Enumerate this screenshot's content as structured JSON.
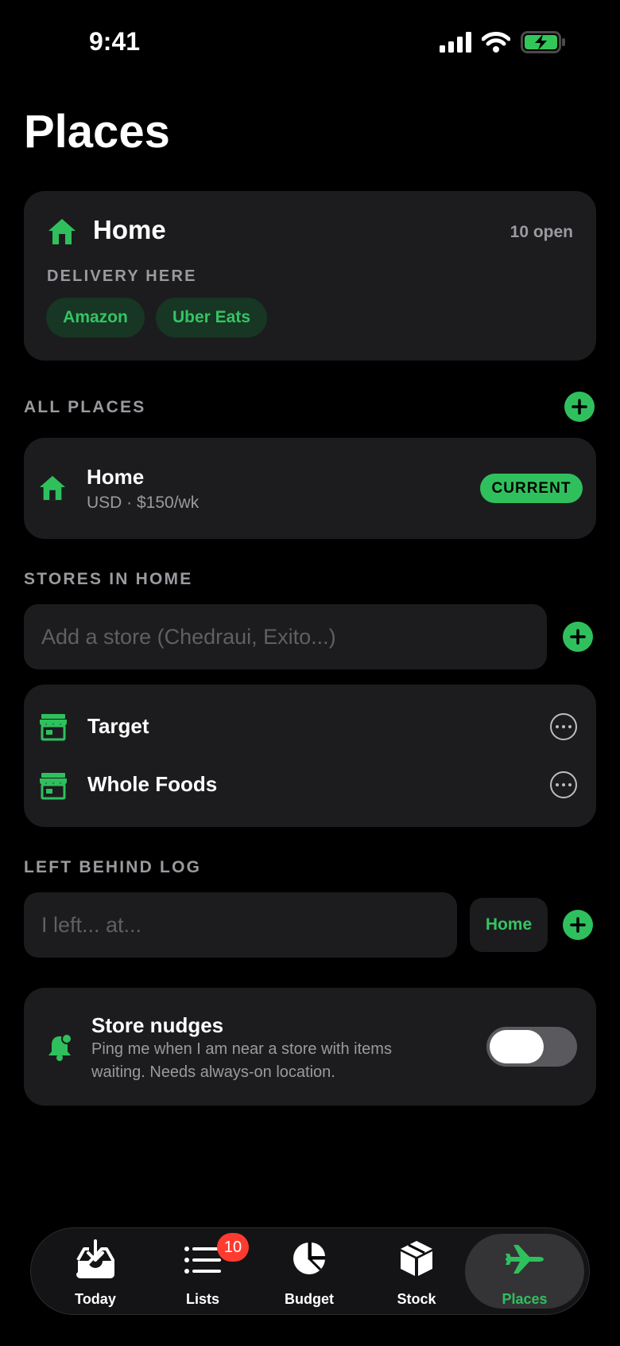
{
  "status_bar": {
    "time": "9:41"
  },
  "page": {
    "title": "Places"
  },
  "current_place": {
    "name": "Home",
    "open_count": "10 open",
    "delivery_label": "DELIVERY HERE",
    "delivery_services": [
      "Amazon",
      "Uber Eats"
    ]
  },
  "all_places": {
    "section_label": "ALL PLACES",
    "items": [
      {
        "name": "Home",
        "detail": "USD · $150/wk",
        "badge": "CURRENT"
      }
    ]
  },
  "stores": {
    "section_label": "STORES IN HOME",
    "input_placeholder": "Add a store (Chedraui, Exito...)",
    "items": [
      {
        "name": "Target"
      },
      {
        "name": "Whole Foods"
      }
    ]
  },
  "left_behind": {
    "section_label": "LEFT BEHIND LOG",
    "input_placeholder": "I left... at...",
    "place_value": "Home"
  },
  "nudges": {
    "title": "Store nudges",
    "description_line1": "Ping me when I am near a store with items",
    "description_line2": "waiting. Needs always-on location.",
    "enabled": false
  },
  "tab_bar": {
    "tabs": [
      {
        "label": "Today",
        "icon": "tray-download-icon"
      },
      {
        "label": "Lists",
        "icon": "list-icon",
        "badge": "10"
      },
      {
        "label": "Budget",
        "icon": "pie-chart-icon"
      },
      {
        "label": "Stock",
        "icon": "box-icon"
      },
      {
        "label": "Places",
        "icon": "airplane-icon",
        "active": true
      }
    ]
  },
  "colors": {
    "accent": "#2fc05d",
    "card": "#1c1c1e",
    "badge": "#ff3b30"
  }
}
